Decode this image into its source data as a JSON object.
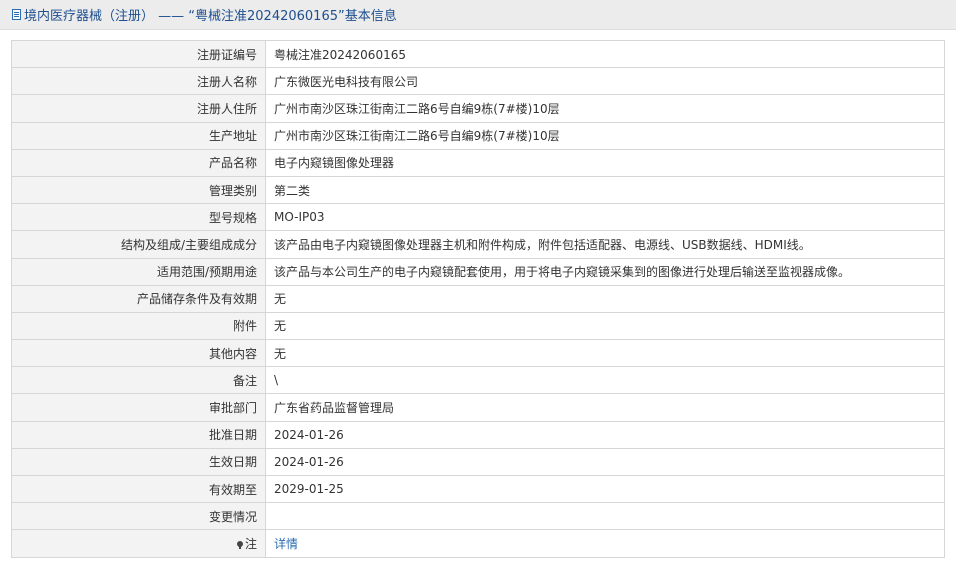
{
  "header": {
    "icon": "document-icon",
    "title": "境内医疗器械（注册） —— “粤械注准20242060165”基本信息"
  },
  "rows": [
    {
      "label": "注册证编号",
      "value": "粤械注准20242060165"
    },
    {
      "label": "注册人名称",
      "value": "广东微医光电科技有限公司"
    },
    {
      "label": "注册人住所",
      "value": "广州市南沙区珠江街南江二路6号自编9栋(7#楼)10层"
    },
    {
      "label": "生产地址",
      "value": "广州市南沙区珠江街南江二路6号自编9栋(7#楼)10层"
    },
    {
      "label": "产品名称",
      "value": "电子内窥镜图像处理器"
    },
    {
      "label": "管理类别",
      "value": "第二类"
    },
    {
      "label": "型号规格",
      "value": "MO-IP03"
    },
    {
      "label": "结构及组成/主要组成成分",
      "value": "该产品由电子内窥镜图像处理器主机和附件构成，附件包括适配器、电源线、USB数据线、HDMI线。"
    },
    {
      "label": "适用范围/预期用途",
      "value": "该产品与本公司生产的电子内窥镜配套使用，用于将电子内窥镜采集到的图像进行处理后输送至监视器成像。"
    },
    {
      "label": "产品储存条件及有效期",
      "value": "无"
    },
    {
      "label": "附件",
      "value": "无"
    },
    {
      "label": "其他内容",
      "value": "无"
    },
    {
      "label": "备注",
      "value": "\\"
    },
    {
      "label": "审批部门",
      "value": "广东省药品监督管理局"
    },
    {
      "label": "批准日期",
      "value": "2024-01-26"
    },
    {
      "label": "生效日期",
      "value": "2024-01-26"
    },
    {
      "label": "有效期至",
      "value": "2029-01-25"
    },
    {
      "label": "变更情况",
      "value": ""
    }
  ],
  "note_row": {
    "icon": "pin-icon",
    "label": "注",
    "link_text": "详情"
  }
}
